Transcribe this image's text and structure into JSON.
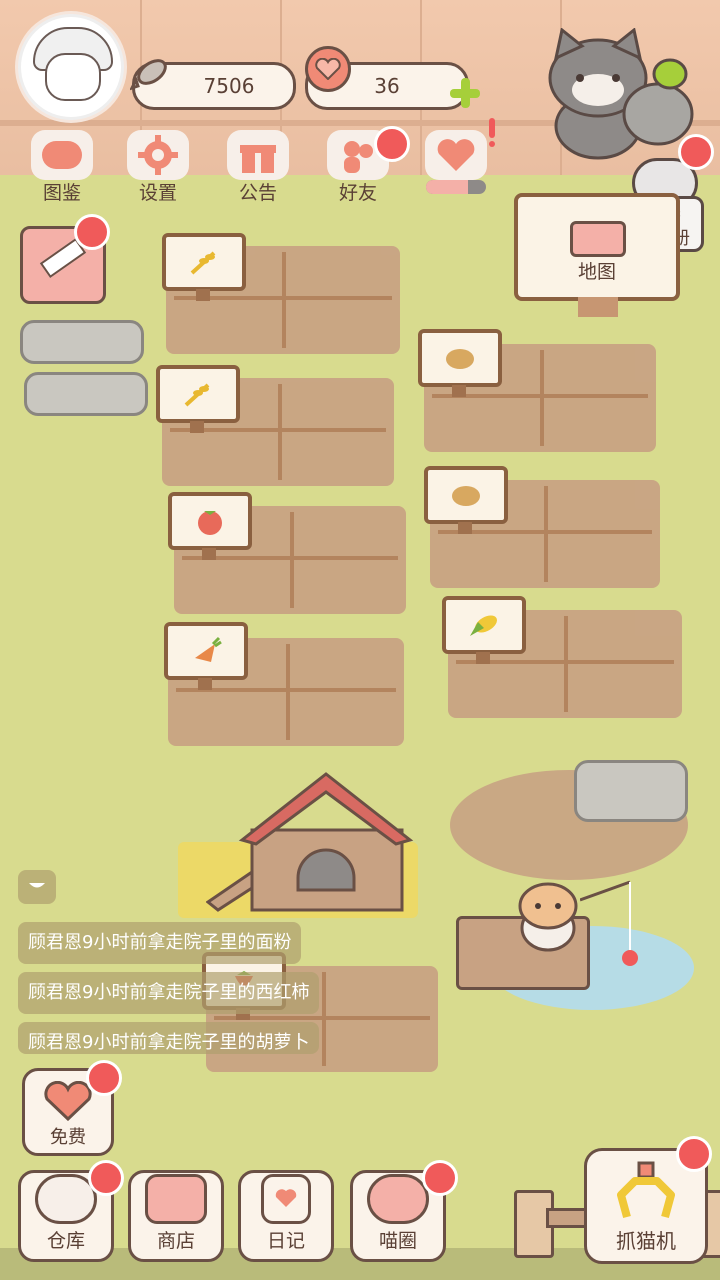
{
  "resources": {
    "fish_count": "7506",
    "heart_count": "36"
  },
  "top_menu": [
    {
      "label": "图鉴"
    },
    {
      "label": "设置"
    },
    {
      "label": "公告"
    },
    {
      "label": "好友"
    }
  ],
  "side": {
    "yearbook_label": "青春\n纪念册",
    "map_label": "地图"
  },
  "notifications": [
    "顾君恩9小时前拿走院子里的面粉",
    "顾君恩9小时前拿走院子里的西红柿",
    "顾君恩9小时前拿走院子里的胡萝卜"
  ],
  "free_label": "免费",
  "bottom_nav": [
    {
      "label": "仓库"
    },
    {
      "label": "商店"
    },
    {
      "label": "日记"
    },
    {
      "label": "喵圈"
    }
  ],
  "claw_label": "抓猫机",
  "colors": {
    "badge": "#f05a5a",
    "accent": "#f08a76",
    "grass": "#d8db8e",
    "soil": "#c8a283"
  },
  "fields": [
    {
      "crop": "wheat"
    },
    {
      "crop": "wheat"
    },
    {
      "crop": "tomato"
    },
    {
      "crop": "carrot"
    },
    {
      "crop": "potato"
    },
    {
      "crop": "potato"
    },
    {
      "crop": "corn"
    },
    {
      "crop": "strawberry"
    }
  ]
}
